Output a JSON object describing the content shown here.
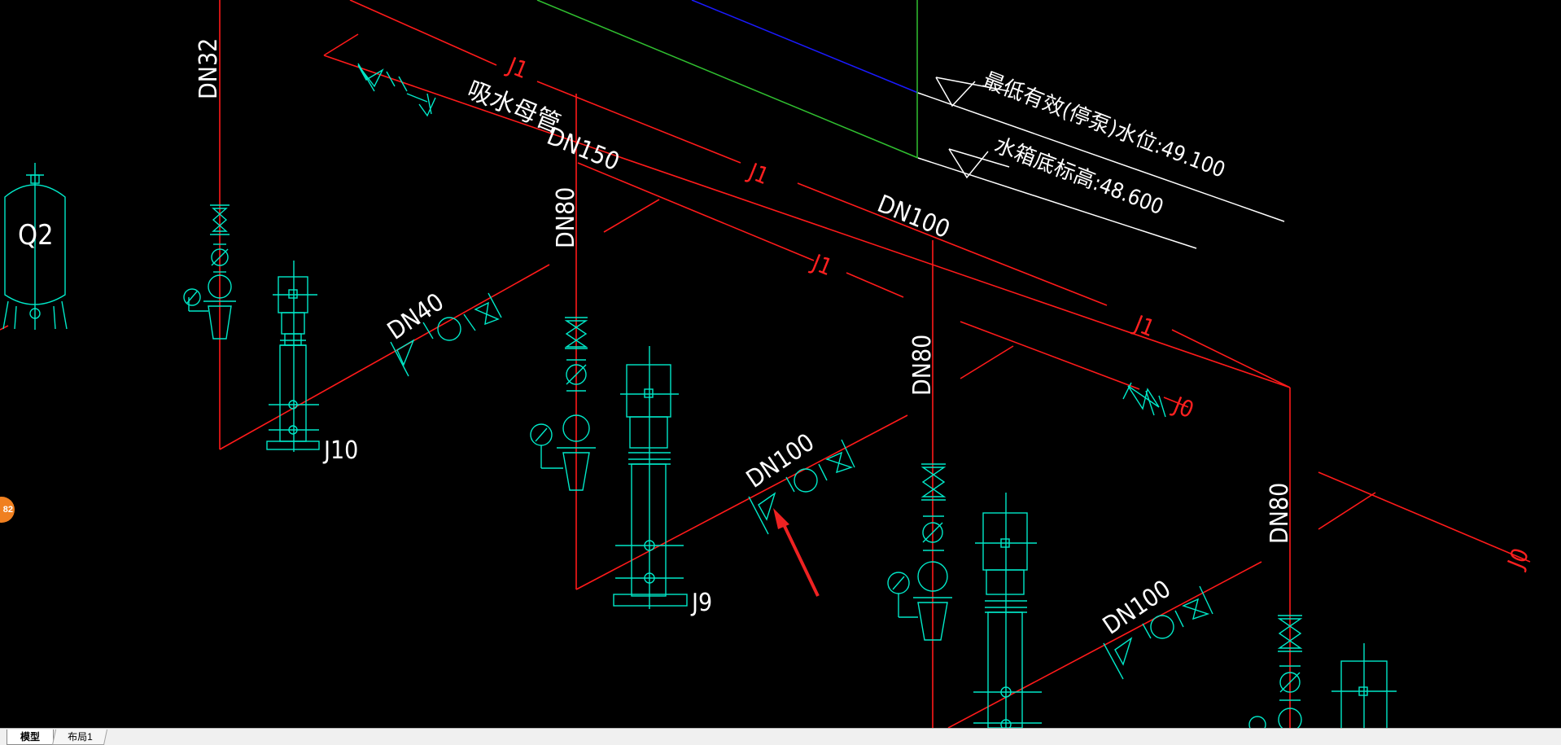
{
  "drawing": {
    "labels": {
      "dn32": "DN32",
      "q2": "Q2",
      "j1_a": "J1",
      "suction_header": "吸水母管",
      "dn150": "DN150",
      "lowest_level": "最低有效(停泵)水位:49.100",
      "tank_bottom": "水箱底标高:48.600",
      "dn80_a": "DN80",
      "j1_b": "J1",
      "dn100_top": "DN100",
      "j1_c": "J1",
      "dn40": "DN40",
      "j10": "J10",
      "dn80_b": "DN80",
      "j1_d": "J1",
      "j0_a": "J0",
      "dn100_mid": "DN100",
      "j9": "J9",
      "dn80_c": "DN80",
      "dn100_low": "DN100",
      "j0_b": "J0"
    },
    "colors": {
      "background": "#000000",
      "pipe_red": "#ff1a1a",
      "equipment_cyan": "#00e8c8",
      "text_white": "#ffffff",
      "line_green": "#30c030",
      "line_blue": "#1a1aff",
      "arrow_red": "#ee2222"
    }
  },
  "badge": {
    "text": "82"
  },
  "tabs": {
    "model": "模型",
    "layout1": "布局1"
  }
}
